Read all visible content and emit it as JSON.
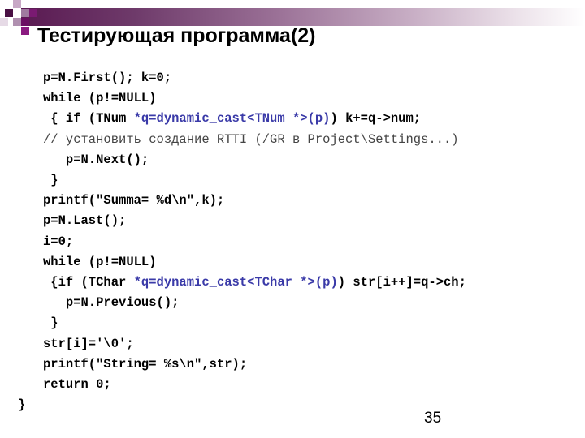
{
  "slide": {
    "title": "Тестирующая программа(2)",
    "page_number": "35",
    "accent_colors": {
      "band_start": "#5a1a52",
      "band_end": "#ffffff",
      "keyword_blue": "#3a3aa8",
      "comment_grey": "#444444"
    }
  },
  "code": {
    "lines": [
      {
        "pre": "p=N.First(); k=0;",
        "blue": "",
        "post": ""
      },
      {
        "pre": "while (p!=NULL)",
        "blue": "",
        "post": ""
      },
      {
        "pre": " { if (TNum ",
        "blue": "*q=dynamic_cast<TNum *>(p)",
        "post": ") k+=q->num;"
      },
      {
        "comment": "// установить создание RTTI (/GR в Project\\Settings...)"
      },
      {
        "pre": "   p=N.Next();",
        "blue": "",
        "post": ""
      },
      {
        "pre": " }",
        "blue": "",
        "post": ""
      },
      {
        "pre": "printf(\"Summa= %d\\n\",k);",
        "blue": "",
        "post": ""
      },
      {
        "pre": "p=N.Last();",
        "blue": "",
        "post": ""
      },
      {
        "pre": "i=0;",
        "blue": "",
        "post": ""
      },
      {
        "pre": "while (p!=NULL)",
        "blue": "",
        "post": ""
      },
      {
        "pre": " {if (TChar ",
        "blue": "*q=dynamic_cast<TChar *>(p)",
        "post": ") str[i++]=q->ch;"
      },
      {
        "pre": "   p=N.Previous();",
        "blue": "",
        "post": ""
      },
      {
        "pre": " }",
        "blue": "",
        "post": ""
      },
      {
        "pre": "str[i]='\\0';",
        "blue": "",
        "post": ""
      },
      {
        "pre": "printf(\"String= %s\\n\",str);",
        "blue": "",
        "post": ""
      },
      {
        "pre": "return 0;",
        "blue": "",
        "post": ""
      }
    ],
    "closing_brace": "}"
  }
}
